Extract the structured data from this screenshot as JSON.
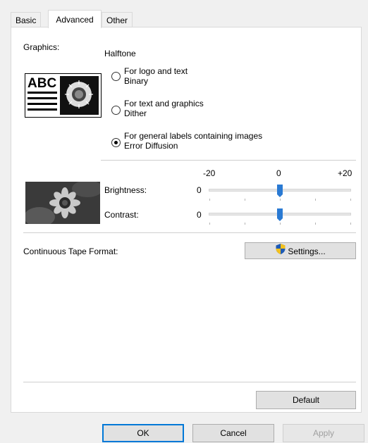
{
  "tabs": [
    {
      "label": "Basic"
    },
    {
      "label": "Advanced",
      "active": true
    },
    {
      "label": "Other"
    }
  ],
  "graphics": {
    "label": "Graphics:",
    "halftone_label": "Halftone",
    "preview_text": "ABC",
    "options": [
      {
        "line1": "For logo and text",
        "line2": "Binary",
        "checked": false
      },
      {
        "line1": "For text and graphics",
        "line2": "Dither",
        "checked": false
      },
      {
        "line1": "For general labels containing images",
        "line2": "Error Diffusion",
        "checked": true
      }
    ]
  },
  "scale": {
    "min": "-20",
    "mid": "0",
    "max": "+20"
  },
  "brightness": {
    "label": "Brightness:",
    "value": "0",
    "level": 0
  },
  "contrast": {
    "label": "Contrast:",
    "value": "0",
    "level": 0
  },
  "continuous": {
    "label": "Continuous Tape Format:",
    "settings_label": "Settings..."
  },
  "buttons": {
    "default_label": "Default",
    "ok": "OK",
    "cancel": "Cancel",
    "apply": "Apply"
  },
  "colors": {
    "accent": "#0078d7",
    "thumb": "#2a7ad3",
    "shield_blue": "#1e5bb5",
    "shield_yellow": "#f2c01e"
  }
}
